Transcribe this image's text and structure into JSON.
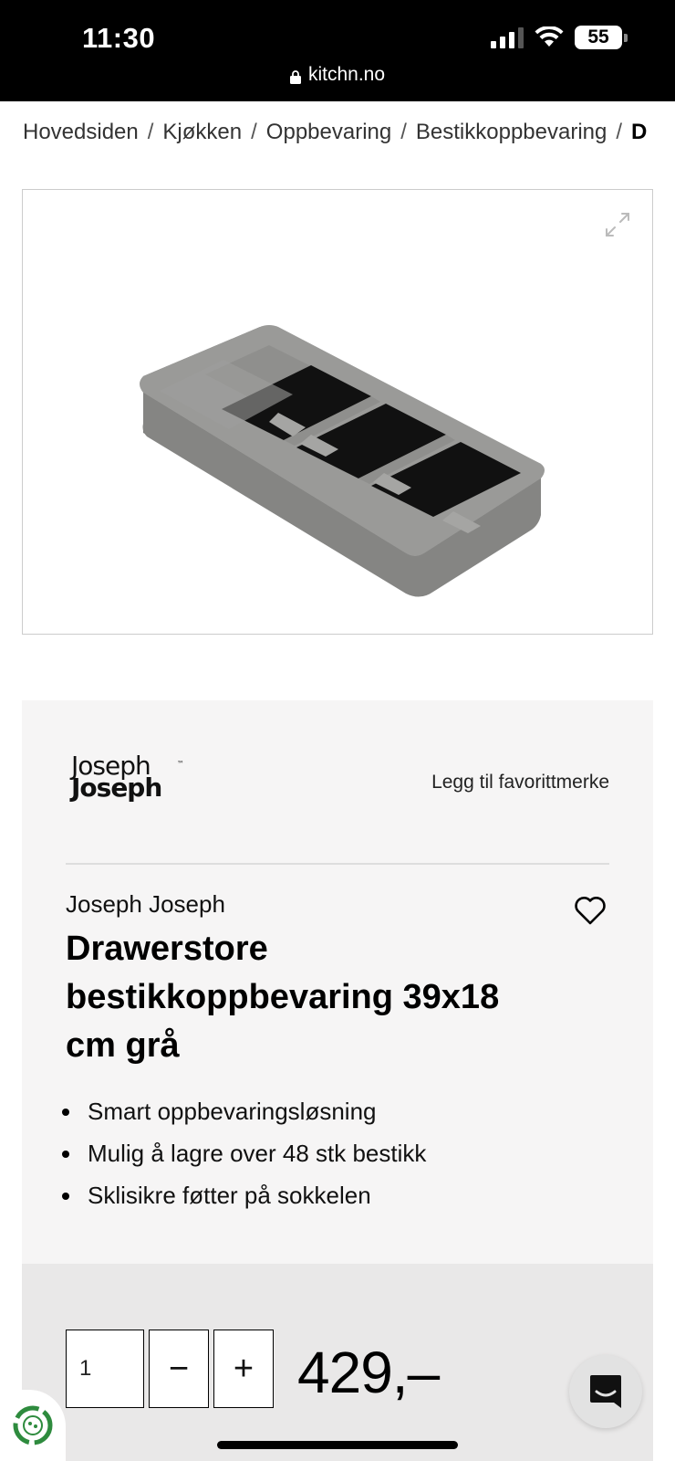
{
  "status_bar": {
    "time": "11:30",
    "battery": "55",
    "url": "kitchn.no"
  },
  "breadcrumb": {
    "items": [
      "Hovedsiden",
      "Kjøkken",
      "Oppbevaring",
      "Bestikkoppbevaring",
      "D"
    ],
    "separator": "/"
  },
  "product_image": {
    "expand_icon": "expand-icon",
    "alt": ""
  },
  "brand_logo": {
    "line1": "Joseph",
    "line2": "Joseph",
    "tm": "™"
  },
  "favorite_brand_label": "Legg til favorittmerke",
  "product": {
    "brand": "Joseph Joseph",
    "title": "Drawerstore bestikkoppbevaring 39x18 cm grå",
    "features": [
      "Smart oppbevaringsløsning",
      "Mulig å lagre over 48 stk bestikk",
      "Sklisikre føtter på sokkelen"
    ]
  },
  "buy": {
    "quantity": "1",
    "minus": "−",
    "plus": "+",
    "price": "429,–"
  },
  "colors": {
    "status_bg": "#000000",
    "card_bg": "#f6f5f5",
    "buy_bg": "#e9e8e8",
    "product_gray": "#8a8a88"
  }
}
